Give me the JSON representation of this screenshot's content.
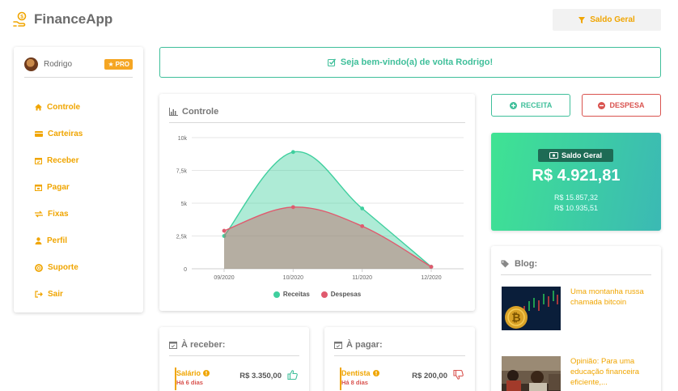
{
  "app": {
    "title": "FinanceApp"
  },
  "header": {
    "saldo_button": "Saldo Geral"
  },
  "sidebar": {
    "user_name": "Rodrigo",
    "badge": "PRO",
    "items": [
      {
        "label": "Controle",
        "icon": "home-icon"
      },
      {
        "label": "Carteiras",
        "icon": "wallet-icon"
      },
      {
        "label": "Receber",
        "icon": "calendar-icon"
      },
      {
        "label": "Pagar",
        "icon": "calendar-icon"
      },
      {
        "label": "Fixas",
        "icon": "exchange-icon"
      },
      {
        "label": "Perfil",
        "icon": "user-icon"
      },
      {
        "label": "Suporte",
        "icon": "lifebuoy-icon"
      },
      {
        "label": "Sair",
        "icon": "sign-out-icon"
      }
    ]
  },
  "welcome": {
    "message": "Seja bem-vindo(a) de volta Rodrigo!"
  },
  "chart_card": {
    "title": "Controle"
  },
  "chart_data": {
    "type": "area",
    "categories": [
      "09/2020",
      "10/2020",
      "11/2020",
      "12/2020"
    ],
    "series": [
      {
        "name": "Receitas",
        "values": [
          2500,
          8900,
          4600,
          150
        ],
        "color": "#3fcf9e"
      },
      {
        "name": "Despesas",
        "values": [
          2900,
          4700,
          3250,
          150
        ],
        "color": "#e05a6e"
      }
    ],
    "yticks": [
      "0",
      "2,5k",
      "5k",
      "7,5k",
      "10k"
    ],
    "ylim": [
      0,
      10000
    ],
    "legend": "bottom-center",
    "grid": true
  },
  "actions": {
    "receita": "RECEITA",
    "despesa": "DESPESA"
  },
  "saldo": {
    "label": "Saldo Geral",
    "value": "R$ 4.921,81",
    "receitas": "R$ 15.857,32",
    "despesas": "R$ 10.935,51"
  },
  "blog": {
    "title": "Blog:",
    "posts": [
      {
        "title": "Uma montanha russa chamada bitcoin"
      },
      {
        "title": "Opinião: Para uma educação financeira eficiente,..."
      }
    ]
  },
  "receber": {
    "title": "À receber:",
    "item": {
      "name": "Salário",
      "due": "Há 6 dias",
      "amount": "R$ 3.350,00"
    }
  },
  "pagar": {
    "title": "À pagar:",
    "item": {
      "name": "Dentista",
      "due": "Há 8 dias",
      "amount": "R$ 200,00"
    }
  },
  "colors": {
    "accent": "#f0a500",
    "green": "#3fbf9a",
    "red": "#d9534f"
  }
}
